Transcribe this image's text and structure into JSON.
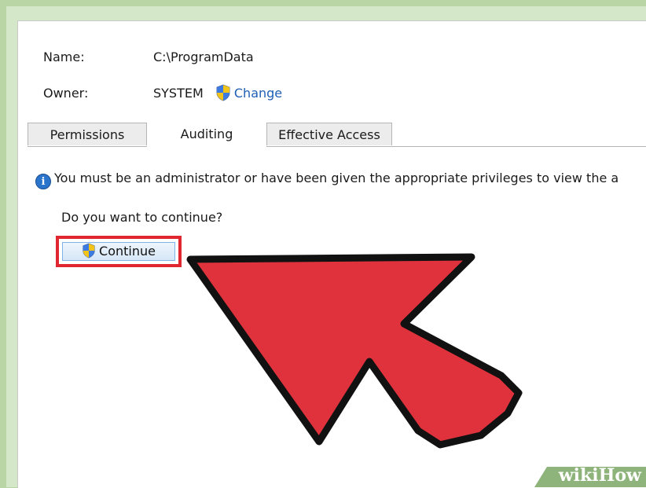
{
  "properties": {
    "name_label": "Name:",
    "name_value": "C:\\ProgramData",
    "owner_label": "Owner:",
    "owner_value": "SYSTEM",
    "change_link": "Change"
  },
  "tabs": [
    {
      "label": "Permissions",
      "active": false
    },
    {
      "label": "Auditing",
      "active": true
    },
    {
      "label": "Effective Access",
      "active": false
    }
  ],
  "message": "You must be an administrator or have been given the appropriate privileges to view the a",
  "question": "Do you want to continue?",
  "continue_button": "Continue",
  "watermark": {
    "part1": "wiki",
    "part2": "How"
  },
  "colors": {
    "highlight": "#e0262f",
    "arrow": "#e0323c",
    "link": "#1e5fb4",
    "background": "#b9d5a6"
  },
  "icons": {
    "shield": "uac-shield-icon",
    "info": "info-icon",
    "arrow": "pointer-arrow-icon"
  }
}
